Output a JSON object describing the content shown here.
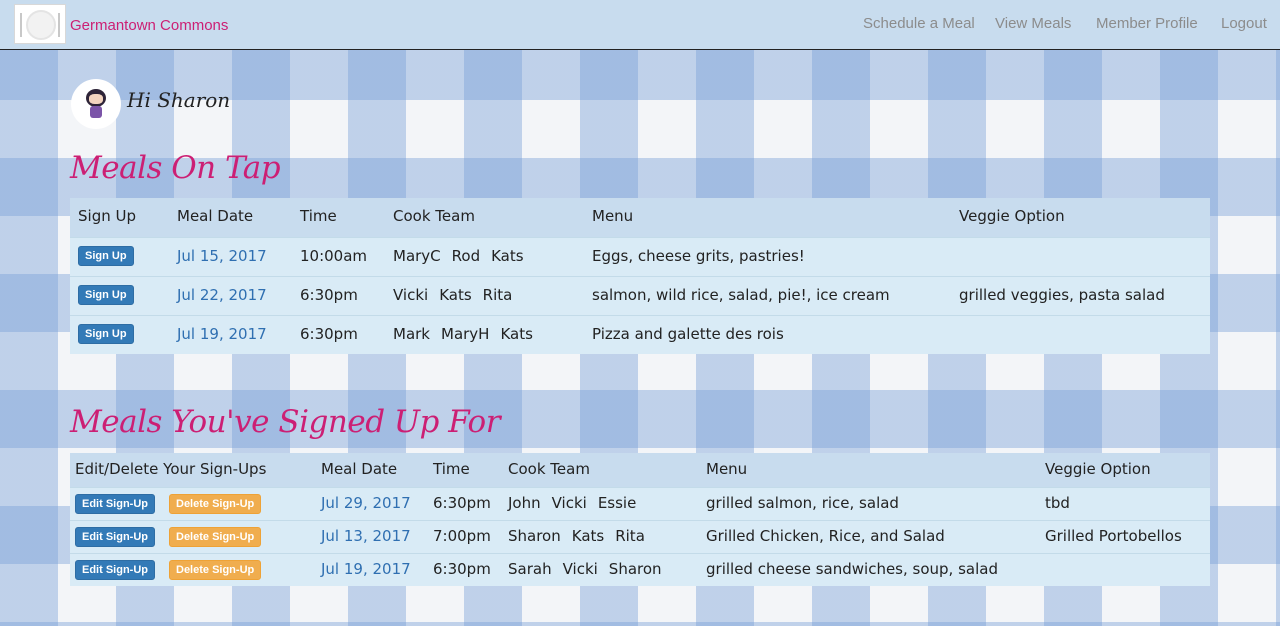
{
  "nav": {
    "brand": "Germantown Commons",
    "links": [
      "Schedule a Meal",
      "View Meals",
      "Member Profile",
      "Logout"
    ]
  },
  "greeting": "Hi Sharon",
  "meals_on_tap": {
    "title": "Meals On Tap",
    "headers": [
      "Sign Up",
      "Meal Date",
      "Time",
      "Cook Team",
      "Menu",
      "Veggie Option"
    ],
    "button_label": "Sign Up",
    "rows": [
      {
        "date": "Jul 15, 2017",
        "time": "10:00am",
        "cooks": [
          "MaryC",
          "Rod",
          "Kats"
        ],
        "menu": "Eggs, cheese grits, pastries!",
        "veggie": ""
      },
      {
        "date": "Jul 22, 2017",
        "time": "6:30pm",
        "cooks": [
          "Vicki",
          "Kats",
          "Rita"
        ],
        "menu": "salmon, wild rice, salad, pie!, ice cream",
        "veggie": "grilled veggies, pasta salad"
      },
      {
        "date": "Jul 19, 2017",
        "time": "6:30pm",
        "cooks": [
          "Mark",
          "MaryH",
          "Kats"
        ],
        "menu": "Pizza and galette des rois",
        "veggie": ""
      }
    ]
  },
  "signed_up": {
    "title": "Meals You've Signed Up For",
    "headers": [
      "Edit/Delete Your Sign-Ups",
      "Meal Date",
      "Time",
      "Cook Team",
      "Menu",
      "Veggie Option"
    ],
    "edit_label": "Edit Sign-Up",
    "delete_label": "Delete Sign-Up",
    "rows": [
      {
        "date": "Jul 29, 2017",
        "time": "6:30pm",
        "cooks": [
          "John",
          "Vicki",
          "Essie"
        ],
        "menu": "grilled salmon, rice, salad",
        "veggie": "tbd"
      },
      {
        "date": "Jul 13, 2017",
        "time": "7:00pm",
        "cooks": [
          "Sharon",
          "Kats",
          "Rita"
        ],
        "menu": "Grilled Chicken, Rice, and Salad",
        "veggie": "Grilled Portobellos"
      },
      {
        "date": "Jul 19, 2017",
        "time": "6:30pm",
        "cooks": [
          "Sarah",
          "Vicki",
          "Sharon"
        ],
        "menu": "grilled cheese sandwiches, soup, salad",
        "veggie": ""
      }
    ]
  },
  "colors": {
    "brand_pink": "#cc1f74",
    "nav_bg": "#c8dcee",
    "row_bg": "#d9ebf6",
    "link_blue": "#2f6fb1",
    "btn_blue": "#337ab7",
    "btn_orange": "#f0ad4e"
  }
}
